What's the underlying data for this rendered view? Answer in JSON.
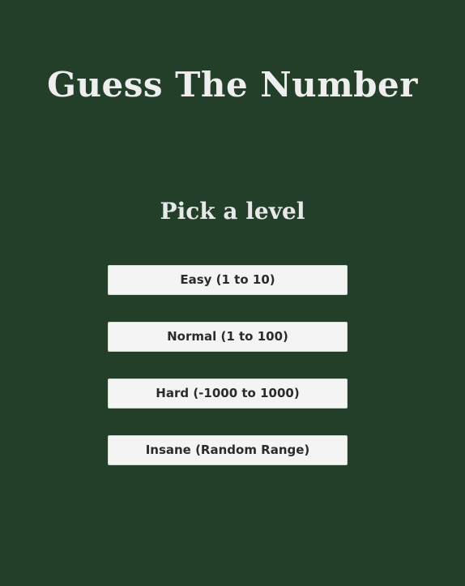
{
  "app": {
    "title": "Guess The Number",
    "subtitle": "Pick a level"
  },
  "levels": [
    {
      "label": "Easy (1 to 10)"
    },
    {
      "label": "Normal (1 to 100)"
    },
    {
      "label": "Hard (-1000 to 1000)"
    },
    {
      "label": "Insane (Random Range)"
    }
  ],
  "colors": {
    "background": "#233f2a",
    "text": "#eeeeee",
    "button": "#f4f4f4",
    "button_text": "#2b2b2b"
  }
}
